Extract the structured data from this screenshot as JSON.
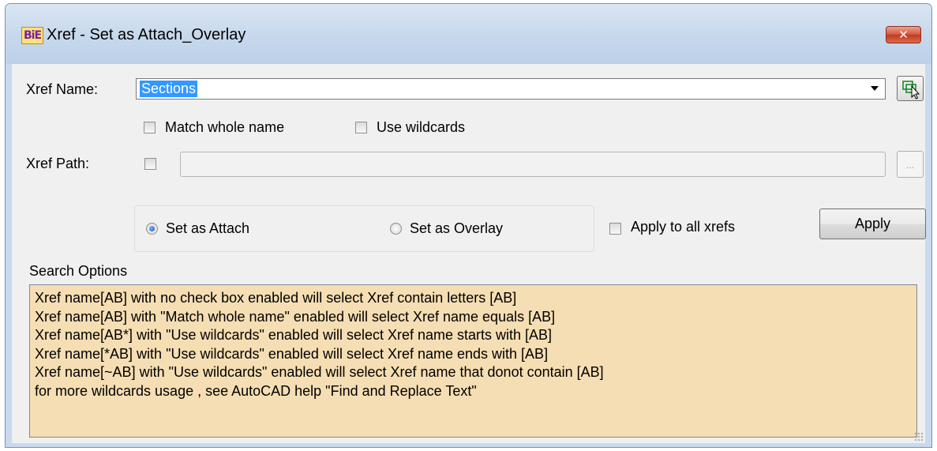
{
  "window": {
    "title": "Xref - Set as Attach_Overlay",
    "app_icon_text": "BiE",
    "close_icon": "close-icon"
  },
  "form": {
    "xref_name_label": "Xref Name:",
    "xref_name_value": "Sections",
    "match_whole_name": {
      "label": "Match whole name",
      "checked": false
    },
    "use_wildcards": {
      "label": "Use wildcards",
      "checked": false
    },
    "xref_path_label": "Xref  Path:",
    "xref_path_checked": false,
    "xref_path_value": "",
    "browse_label": "...",
    "pick_icon": "pick-object-icon"
  },
  "mode": {
    "attach_label": "Set as Attach",
    "overlay_label": "Set as Overlay",
    "selected": "attach"
  },
  "apply_all": {
    "label": "Apply to all xrefs",
    "checked": false
  },
  "apply_button": "Apply",
  "search_options": {
    "heading": "Search Options",
    "lines": [
      "Xref name[AB] with no check box enabled will select Xref contain letters [AB]",
      "Xref name[AB] with \"Match whole name\" enabled will select Xref name equals [AB]",
      "Xref name[AB*] with \"Use wildcards\" enabled will select Xref name starts with [AB]",
      "Xref name[*AB] with \"Use wildcards\" enabled will select Xref name ends with [AB]",
      "Xref name[~AB] with \"Use wildcards\" enabled will select Xref name that donot contain [AB]",
      "for more wildcards usage , see AutoCAD help  \"Find and Replace Text\""
    ],
    "background": "#f5deb3"
  }
}
